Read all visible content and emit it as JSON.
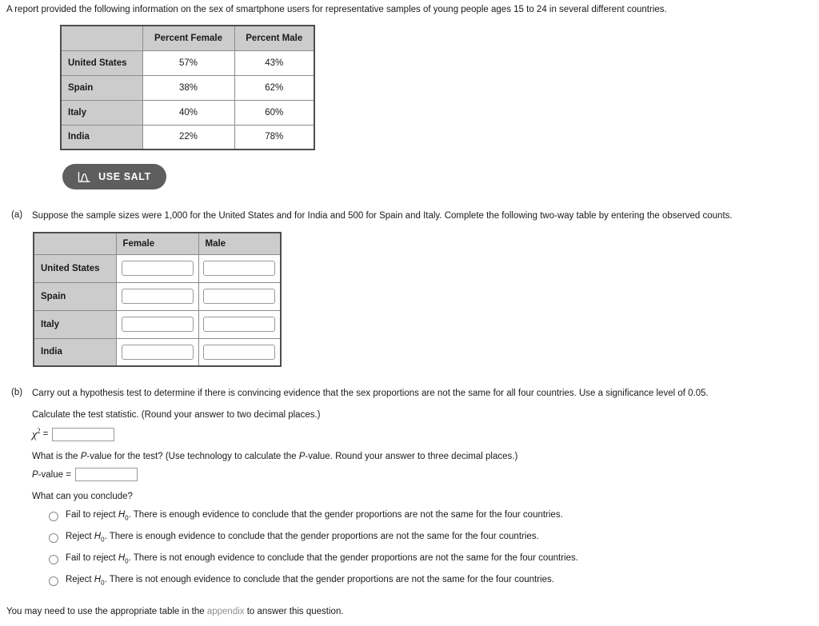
{
  "intro": "A report provided the following information on the sex of smartphone users for representative samples of young people ages 15 to 24 in several different countries.",
  "percent_table": {
    "corner": "",
    "columns": [
      "Percent Female",
      "Percent Male"
    ],
    "rows": [
      {
        "label": "United States",
        "female": "57%",
        "male": "43%"
      },
      {
        "label": "Spain",
        "female": "38%",
        "male": "62%"
      },
      {
        "label": "Italy",
        "female": "40%",
        "male": "60%"
      },
      {
        "label": "India",
        "female": "22%",
        "male": "78%"
      }
    ]
  },
  "salt_button": {
    "label": "USE SALT",
    "icon": "normal-distribution-icon",
    "background": "#5e5e5e",
    "text_color": "#ffffff"
  },
  "part_a": {
    "label": "(a)",
    "text": "Suppose the sample sizes were 1,000 for the United States and for India and 500 for Spain and Italy. Complete the following two-way table by entering the observed counts.",
    "table": {
      "corner": "",
      "columns": [
        "Female",
        "Male"
      ],
      "rows": [
        {
          "label": "United States",
          "female_value": "",
          "male_value": ""
        },
        {
          "label": "Spain",
          "female_value": "",
          "male_value": ""
        },
        {
          "label": "Italy",
          "female_value": "",
          "male_value": ""
        },
        {
          "label": "India",
          "female_value": "",
          "male_value": ""
        }
      ]
    }
  },
  "part_b": {
    "label": "(b)",
    "text": "Carry out a hypothesis test to determine if there is convincing evidence that the sex proportions are not the same for all four countries. Use a significance level of 0.05.",
    "test_statistic_prompt": "Calculate the test statistic. (Round your answer to two decimal places.)",
    "chi_label_symbol": "χ",
    "chi_label_exponent": "2",
    "chi_label_equals": "=",
    "chi_value": "",
    "pvalue_prompt_1": "What is the ",
    "pvalue_prompt_italic_1": "P",
    "pvalue_prompt_2": "-value for the test? (Use technology to calculate the ",
    "pvalue_prompt_italic_2": "P",
    "pvalue_prompt_3": "-value. Round your answer to three decimal places.)",
    "pvalue_label_italic": "P",
    "pvalue_label_rest": "-value  =",
    "pvalue_value": "",
    "conclude_prompt": "What can you conclude?",
    "options": [
      {
        "lead": "Fail to reject ",
        "hypothesis": "H",
        "subscript": "0",
        "rest": ". There is enough evidence to conclude that the gender proportions are not the same for the four countries.",
        "selected": false
      },
      {
        "lead": "Reject ",
        "hypothesis": "H",
        "subscript": "0",
        "rest": ". There is enough evidence to conclude that the gender proportions are not the same for the four countries.",
        "selected": false
      },
      {
        "lead": "Fail to reject ",
        "hypothesis": "H",
        "subscript": "0",
        "rest": ". There is not enough evidence to conclude that the gender proportions are not the same for the four countries.",
        "selected": false
      },
      {
        "lead": "Reject ",
        "hypothesis": "H",
        "subscript": "0",
        "rest": ". There is not enough evidence to conclude that the gender proportions are not the same for the four countries.",
        "selected": false
      }
    ]
  },
  "footer": {
    "before": "You may need to use the appropriate table in the ",
    "link": "appendix",
    "after": " to answer this question."
  }
}
